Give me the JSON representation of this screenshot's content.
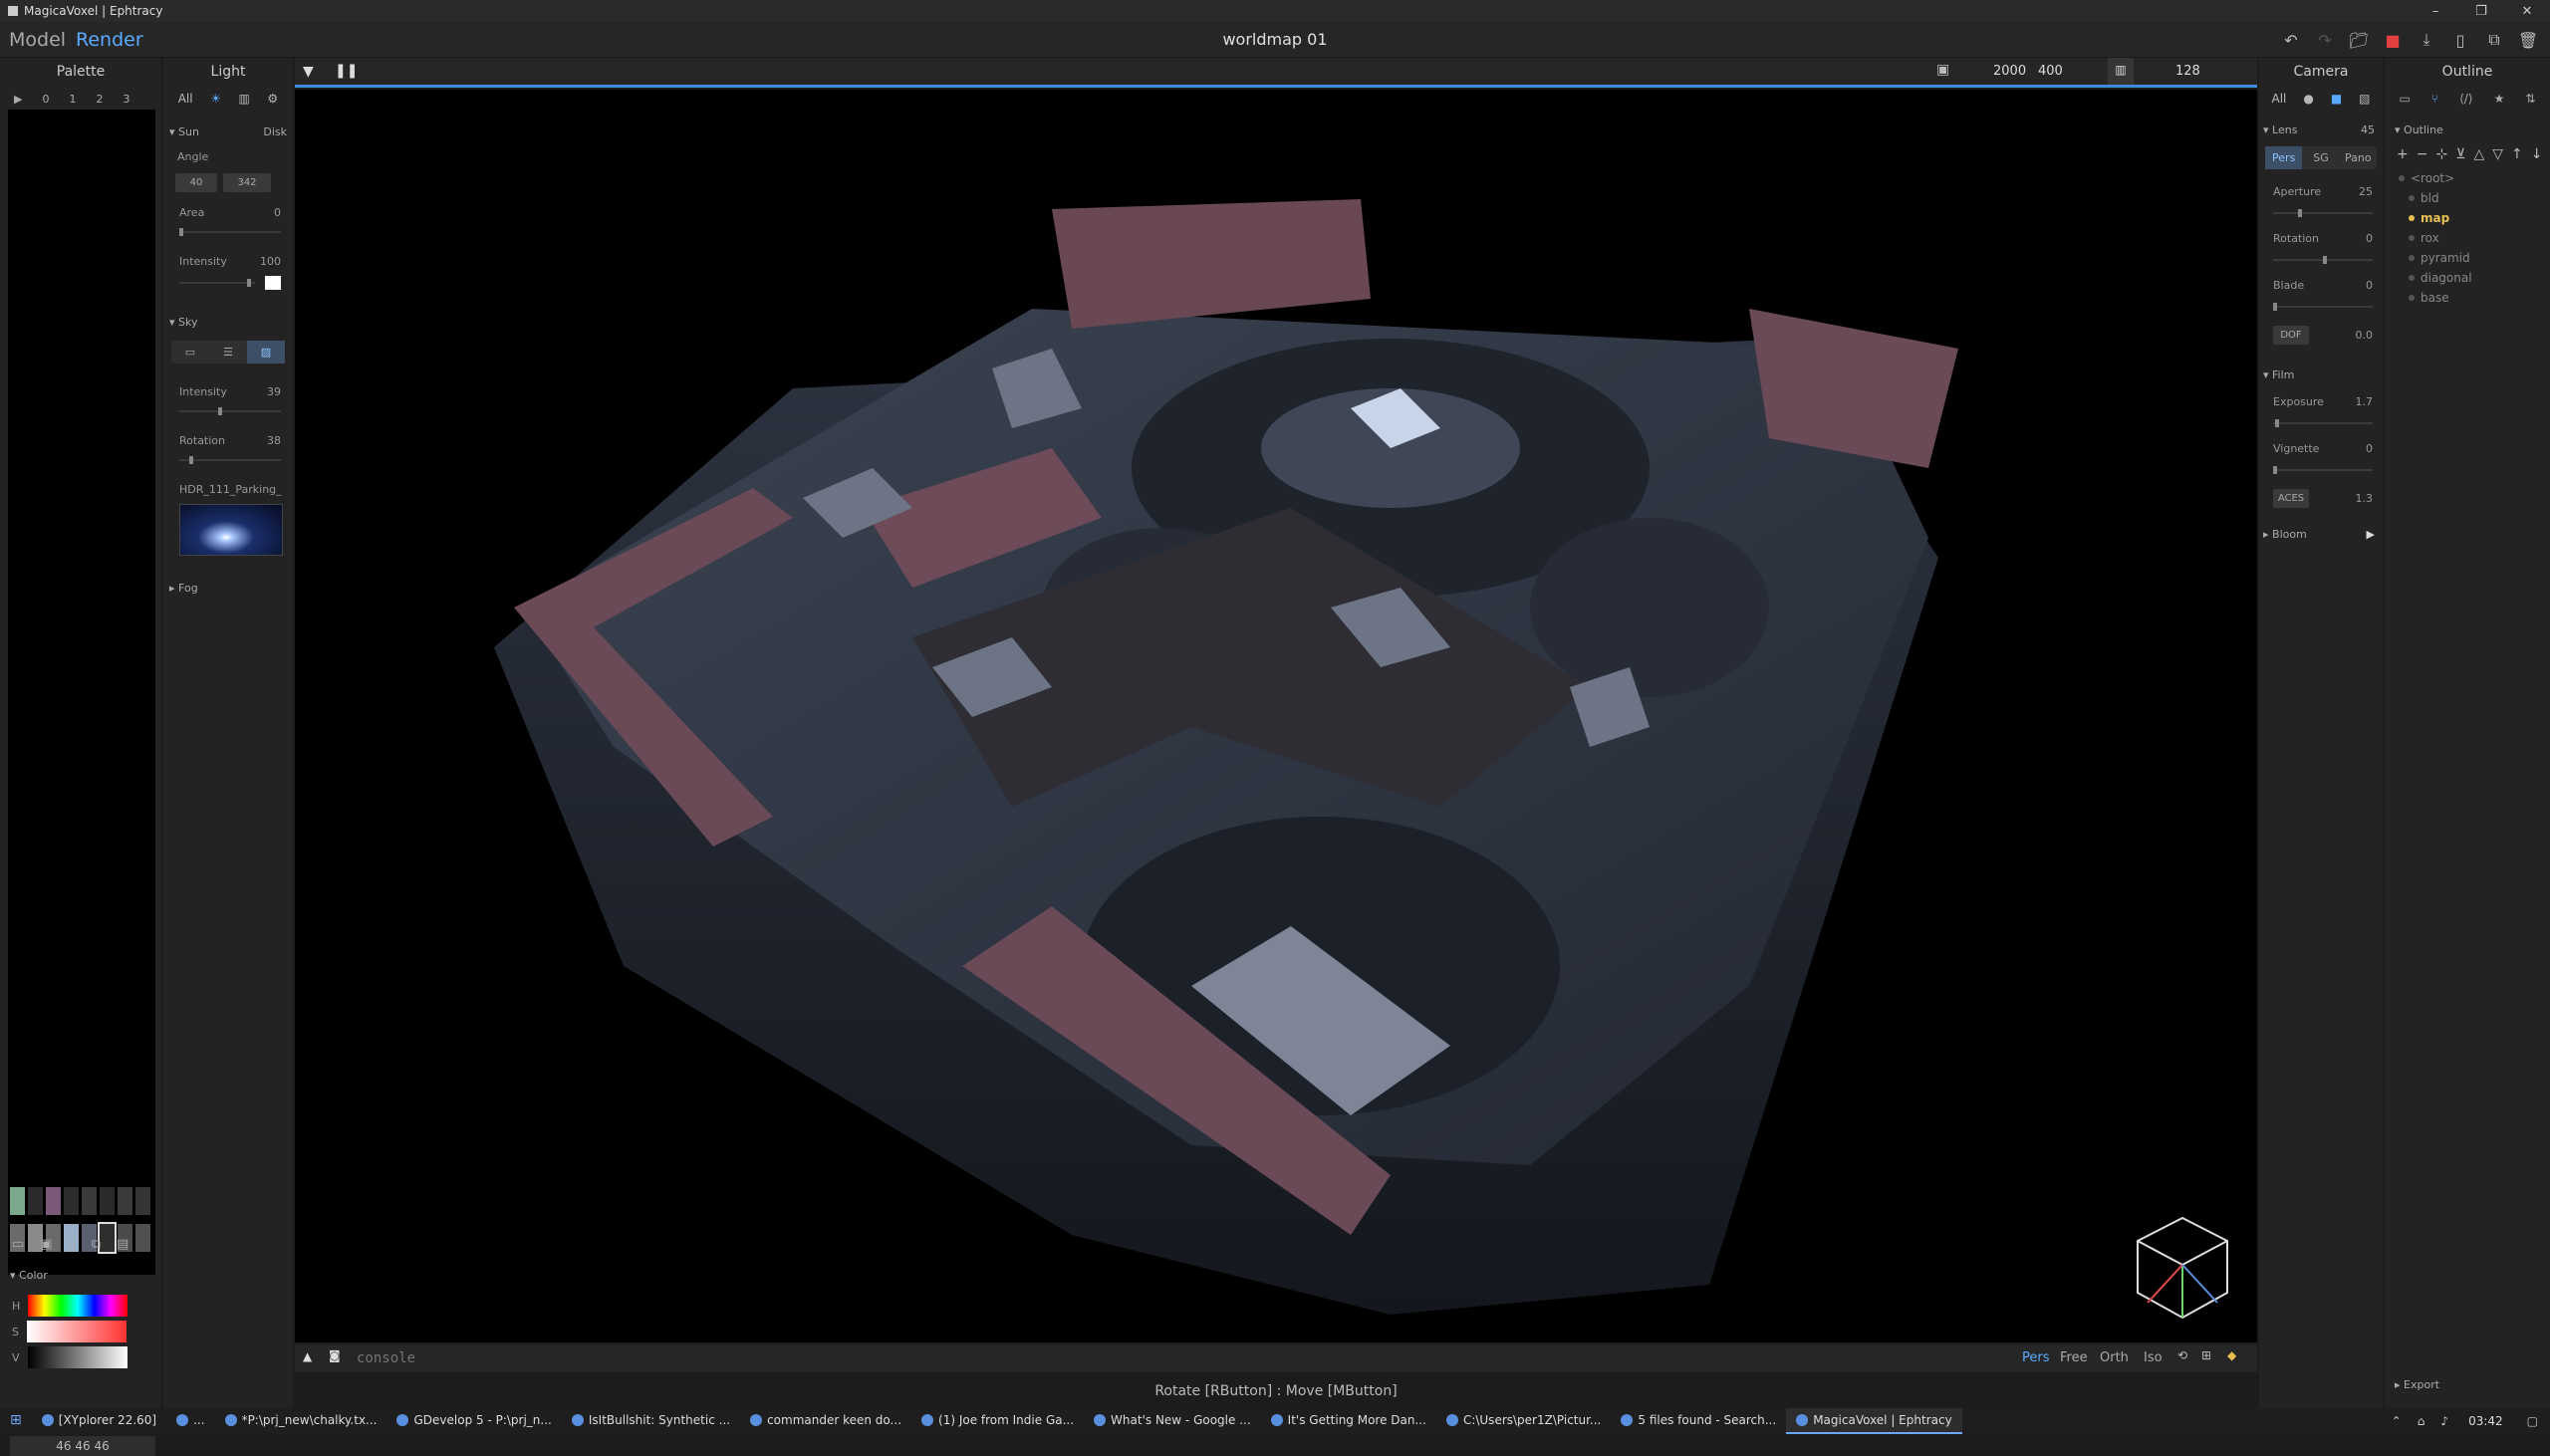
{
  "window": {
    "title": "MagicaVoxel | Ephtracy",
    "minimize": "–",
    "maximize": "❐",
    "close": "✕"
  },
  "menubar": {
    "mode_model": "Model",
    "mode_render": "Render",
    "document_title": "worldmap 01"
  },
  "palette": {
    "title": "Palette",
    "pages": [
      "▶",
      "0",
      "1",
      "2",
      "3"
    ],
    "swatch_colors": [
      "#7aa88a",
      "#2a2a2a",
      "#7a5a78",
      "#2c2c2c",
      "#3a3a3a",
      "#2a2a2a",
      "#3a3a3a",
      "#353535",
      "#6a6a6a",
      "#8a8a8a",
      "#6a6a6a",
      "#9ab0c8",
      "#5a6070",
      "#2e2e2e",
      "#4a4a4a",
      "#505050"
    ],
    "selected_value": "46 46 46",
    "color_label": "Color",
    "h_label": "H",
    "s_label": "S",
    "v_label": "V"
  },
  "light": {
    "title": "Light",
    "tabs": [
      "All"
    ],
    "sun": {
      "label": "Sun",
      "type": "Disk",
      "angle_label": "Angle",
      "angle1": "40",
      "angle2": "342",
      "area_label": "Area",
      "area": "0",
      "intensity_label": "Intensity",
      "intensity": "100"
    },
    "sky": {
      "label": "Sky",
      "intensity_label": "Intensity",
      "intensity": "39",
      "rotation_label": "Rotation",
      "rotation": "38",
      "hdr_name": "HDR_111_Parking_"
    },
    "fog": {
      "label": "Fog"
    }
  },
  "viewport": {
    "resolution_w": "2000",
    "resolution_h": "400",
    "samples": "128",
    "console_placeholder": "console",
    "projections": [
      "Pers",
      "Free",
      "Orth",
      "Iso"
    ],
    "active_projection": "Pers",
    "status": "Rotate [RButton] : Move [MButton]"
  },
  "camera": {
    "title": "Camera",
    "tab_all": "All",
    "lens": {
      "label": "Lens",
      "value": "45",
      "modes": [
        "Pers",
        "SG",
        "Pano"
      ],
      "active": "Pers"
    },
    "aperture_label": "Aperture",
    "aperture": "25",
    "rotation_label": "Rotation",
    "rotation": "0",
    "blade_label": "Blade",
    "blade": "0",
    "dof_label": "DOF",
    "dof": "0.0",
    "film": {
      "label": "Film",
      "exposure_label": "Exposure",
      "exposure": "1.7",
      "vignette_label": "Vignette",
      "vignette": "0",
      "aces_label": "ACES",
      "aces": "1.3"
    },
    "bloom_label": "Bloom"
  },
  "outline": {
    "title": "Outline",
    "section": "Outline",
    "items": [
      "<root>",
      "bld",
      "map",
      "rox",
      "pyramid",
      "diagonal",
      "base"
    ],
    "active": "map",
    "export_label": "Export"
  },
  "taskbar": {
    "items": [
      {
        "label": "[XYplorer 22.60]",
        "active": false
      },
      {
        "label": "...",
        "active": false
      },
      {
        "label": "*P:\\prj_new\\chalky.tx...",
        "active": false
      },
      {
        "label": "GDevelop 5 - P:\\prj_n...",
        "active": false
      },
      {
        "label": "IsItBullshit: Synthetic ...",
        "active": false
      },
      {
        "label": "commander keen do...",
        "active": false
      },
      {
        "label": "(1) Joe from Indie Ga...",
        "active": false
      },
      {
        "label": "What's New - Google ...",
        "active": false
      },
      {
        "label": "It's Getting More Dan...",
        "active": false
      },
      {
        "label": "C:\\Users\\per1Z\\Pictur...",
        "active": false
      },
      {
        "label": "5 files found - Search...",
        "active": false
      },
      {
        "label": "MagicaVoxel | Ephtracy",
        "active": true
      }
    ],
    "clock": "03:42"
  },
  "colors": {
    "accent": "#3c8edc",
    "outline_active": "#e8c050",
    "render_active": "#5aabff"
  }
}
